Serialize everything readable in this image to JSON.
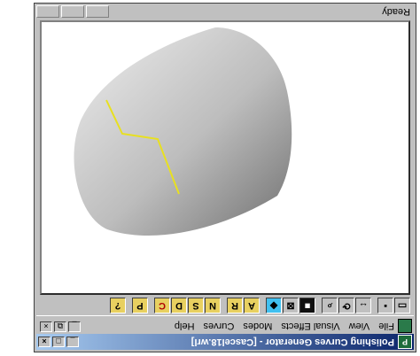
{
  "window": {
    "title": "Polishing Curves Generator - [Cascel18.wrl]",
    "app_icon": "pcg-app-icon",
    "min_glyph": "_",
    "max_glyph": "□",
    "close_glyph": "×"
  },
  "menu": {
    "items": [
      "File",
      "View",
      "Visual Effects",
      "Modes",
      "Curves",
      "Help"
    ],
    "mdi_min": "_",
    "mdi_restore": "⧉",
    "mdi_close": "×"
  },
  "toolbar": {
    "letters": {
      "a": "A",
      "r": "R",
      "n": "N",
      "s": "S",
      "d": "D",
      "c": "C",
      "p": "P",
      "q": "?"
    }
  },
  "status": {
    "text": "Ready"
  },
  "colors": {
    "curve": "#e8e020",
    "titlebar": "#0a246a"
  }
}
